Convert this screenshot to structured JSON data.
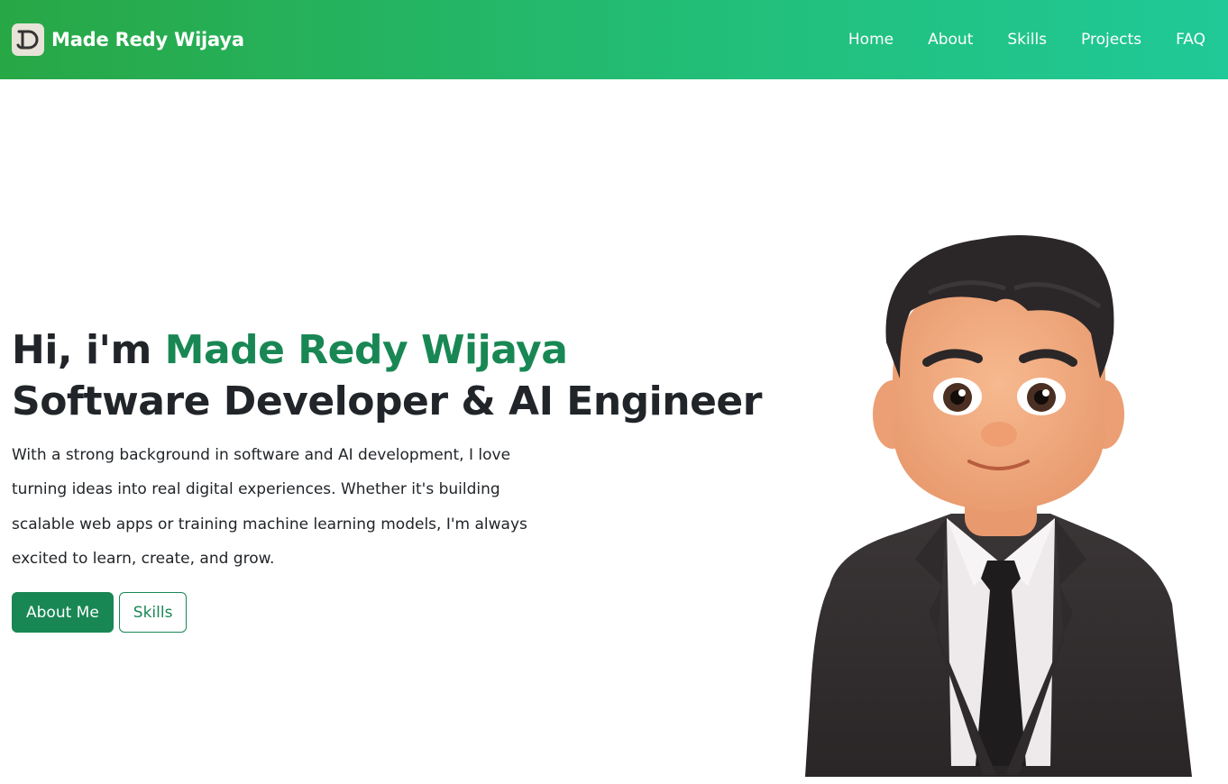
{
  "navbar": {
    "brand_name": "Made Redy Wijaya",
    "logo_icon": "dj-monogram-logo",
    "links": [
      {
        "label": "Home"
      },
      {
        "label": "About"
      },
      {
        "label": "Skills"
      },
      {
        "label": "Projects"
      },
      {
        "label": "FAQ"
      }
    ]
  },
  "hero": {
    "greeting": "Hi, i'm ",
    "name": "Made Redy Wijaya",
    "role": "Software Developer & AI Engineer",
    "description": "With a strong background in software and AI development, I love turning ideas into real digital experiences. Whether it's building scalable web apps or training machine learning models, I'm always excited to learn, create, and grow.",
    "primary_button": "About Me",
    "secondary_button": "Skills",
    "illustration": "cartoon-avatar-in-suit"
  },
  "colors": {
    "accent": "#198754",
    "nav_gradient_start": "#28a745",
    "nav_gradient_end": "#20c997",
    "text": "#212529"
  }
}
